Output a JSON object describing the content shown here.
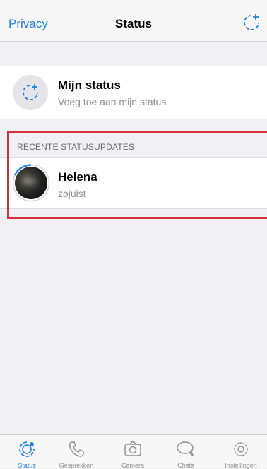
{
  "nav": {
    "back_label": "Privacy",
    "title": "Status",
    "add_icon": "add-status-icon"
  },
  "my_status": {
    "name": "Mijn status",
    "subtitle": "Voeg toe aan mijn status"
  },
  "recent": {
    "header": "RECENTE STATUSUPDATES",
    "items": [
      {
        "name": "Helena",
        "time": "zojuist"
      }
    ]
  },
  "tabbar": {
    "tabs": [
      {
        "label": "Status",
        "icon": "status-icon",
        "active": true
      },
      {
        "label": "Gesprekken",
        "icon": "phone-icon",
        "active": false
      },
      {
        "label": "Camera",
        "icon": "camera-icon",
        "active": false
      },
      {
        "label": "Chats",
        "icon": "chat-bubble-icon",
        "active": false
      },
      {
        "label": "Instellingen",
        "icon": "gear-icon",
        "active": false
      }
    ]
  },
  "colors": {
    "accent": "#1e7fe3",
    "highlight": "#d5303d",
    "background": "#f0f0f5"
  }
}
